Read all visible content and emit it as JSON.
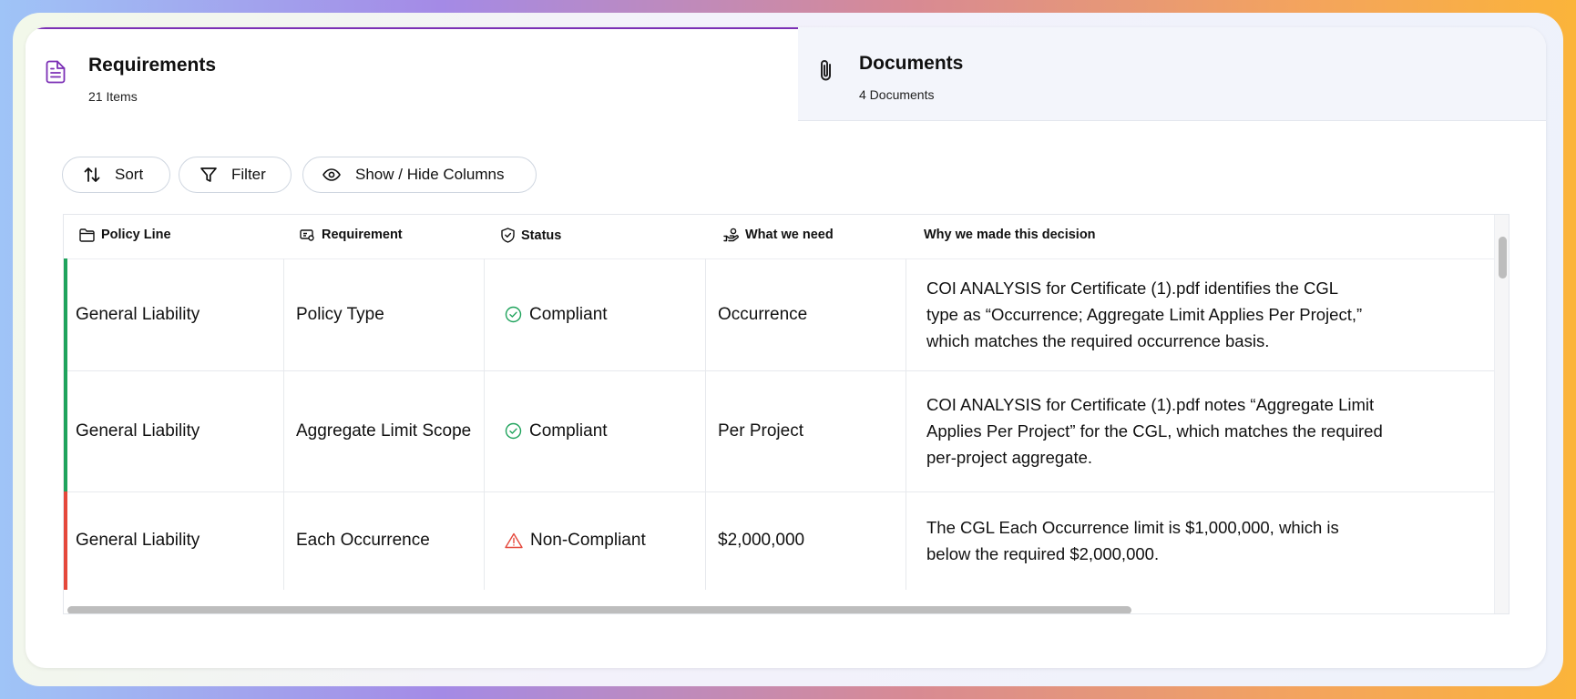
{
  "tabs": [
    {
      "title": "Requirements",
      "subtitle": "21 Items",
      "icon": "document-icon",
      "active": true
    },
    {
      "title": "Documents",
      "subtitle": "4 Documents",
      "icon": "paperclip-icon",
      "active": false
    }
  ],
  "toolbar": {
    "sort_label": "Sort",
    "filter_label": "Filter",
    "columns_label": "Show / Hide Columns"
  },
  "table": {
    "columns": [
      {
        "label": "Policy Line",
        "icon": "folder-icon"
      },
      {
        "label": "Requirement",
        "icon": "requirement-icon"
      },
      {
        "label": "Status",
        "icon": "shield-check-icon"
      },
      {
        "label": "What we need",
        "icon": "hand-coins-icon"
      },
      {
        "label": "Why we made this decision",
        "icon": ""
      }
    ],
    "rows": [
      {
        "policy_line": "General Liability",
        "requirement": "Policy Type",
        "status": "Compliant",
        "status_type": "compliant",
        "what_we_need": "Occurrence",
        "reason": "COI ANALYSIS for Certificate (1).pdf identifies the CGL type as “Occurrence; Aggregate Limit Applies Per Project,” which matches the required occurrence basis."
      },
      {
        "policy_line": "General Liability",
        "requirement": "Aggregate Limit Scope",
        "status": "Compliant",
        "status_type": "compliant",
        "what_we_need": "Per Project",
        "reason": "COI ANALYSIS for Certificate (1).pdf notes “Aggregate Limit Applies Per Project” for the CGL, which matches the required per-project aggregate."
      },
      {
        "policy_line": "General Liability",
        "requirement": "Each Occurrence",
        "status": "Non-Compliant",
        "status_type": "non-compliant",
        "what_we_need": "$2,000,000",
        "reason": "The CGL Each Occurrence limit is $1,000,000, which is below the required $2,000,000."
      }
    ]
  },
  "colors": {
    "accent": "#7b2fb5",
    "compliant": "#1fa35c",
    "non_compliant": "#e5483b"
  }
}
